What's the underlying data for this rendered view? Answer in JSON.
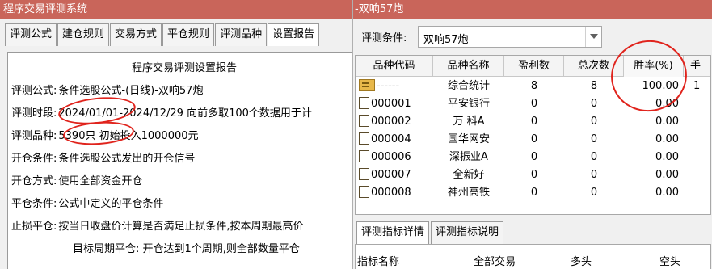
{
  "left_window": {
    "title": "程序交易评测系统",
    "tabs": [
      {
        "label": "评测公式"
      },
      {
        "label": "建仓规则"
      },
      {
        "label": "交易方式"
      },
      {
        "label": "平仓规则"
      },
      {
        "label": "评测品种"
      },
      {
        "label": "设置报告"
      }
    ],
    "report": {
      "heading": "程序交易评测设置报告",
      "lines": [
        {
          "label": "评测公式:",
          "value": "条件选股公式-(日线)-双响57炮"
        },
        {
          "label": "评测时段:",
          "value": "2024/01/01-2024/12/29 向前多取100个数据用于计"
        },
        {
          "label": "评测品种:",
          "value": "5390只 初始投入1000000元"
        },
        {
          "label": "开仓条件:",
          "value": "条件选股公式发出的开仓信号"
        },
        {
          "label": "开仓方式:",
          "value": "使用全部资金开仓"
        },
        {
          "label": "平仓条件:",
          "value": "公式中定义的平仓条件"
        },
        {
          "label": "止损平仓:",
          "value": "按当日收盘价计算是否满足止损条件,按本周期最高价"
        },
        {
          "label": "",
          "value": "目标周期平仓: 开仓达到1个周期,则全部数量平仓"
        }
      ]
    }
  },
  "right_window": {
    "title": "-双响57炮",
    "condition_label": "评测条件:",
    "condition_value": "双响57炮",
    "columns": [
      "品种代码",
      "品种名称",
      "盈利数",
      "总次数",
      "胜率(%)",
      "手"
    ],
    "rows": [
      {
        "code": "------",
        "name": "综合统计",
        "wins": "8",
        "total": "8",
        "rate": "100.00",
        "more": "1",
        "icon": "summary-icon"
      },
      {
        "code": "000001",
        "name": "平安银行",
        "wins": "0",
        "total": "0",
        "rate": "0.00",
        "more": "",
        "icon": "stock-icon"
      },
      {
        "code": "000002",
        "name": "万 科A",
        "wins": "0",
        "total": "0",
        "rate": "0.00",
        "more": "",
        "icon": "stock-icon"
      },
      {
        "code": "000004",
        "name": "国华网安",
        "wins": "0",
        "total": "0",
        "rate": "0.00",
        "more": "",
        "icon": "stock-icon"
      },
      {
        "code": "000006",
        "name": "深振业A",
        "wins": "0",
        "total": "0",
        "rate": "0.00",
        "more": "",
        "icon": "stock-icon"
      },
      {
        "code": "000007",
        "name": "全新好",
        "wins": "0",
        "total": "0",
        "rate": "0.00",
        "more": "",
        "icon": "stock-icon"
      },
      {
        "code": "000008",
        "name": "神州高铁",
        "wins": "0",
        "total": "0",
        "rate": "0.00",
        "more": "",
        "icon": "stock-icon"
      }
    ],
    "bottom_tabs": [
      {
        "label": "评测指标详情"
      },
      {
        "label": "评测指标说明"
      }
    ],
    "metrics_headers": [
      "指标名称",
      "全部交易",
      "多头",
      "空头"
    ]
  },
  "colors": {
    "title_bar": "#c9655a",
    "annotation": "#e0231c",
    "summary_icon": "#e8b84a"
  }
}
